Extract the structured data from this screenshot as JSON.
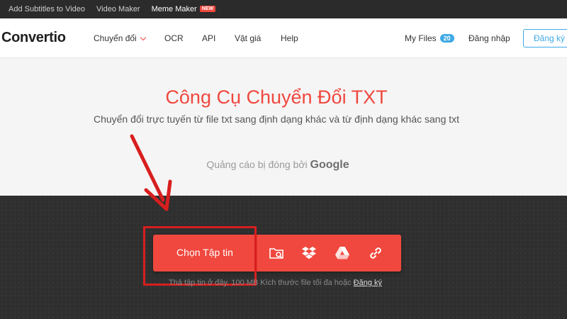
{
  "topbar": {
    "links": [
      "Add Subtitles to Video",
      "Video Maker",
      "Meme Maker"
    ],
    "new_badge": "NEW"
  },
  "header": {
    "logo": "Convertio",
    "nav": [
      "Chuyển đổi",
      "OCR",
      "API",
      "Vật giá",
      "Help"
    ],
    "my_files": "My Files",
    "files_count": "20",
    "login": "Đăng nhập",
    "signup": "Đăng ký"
  },
  "hero": {
    "title": "Công Cụ Chuyển Đổi TXT",
    "subtitle": "Chuyển đổi trực tuyến từ file txt sang định dạng khác và từ định dạng khác sang txt",
    "ad_text": "Quảng cáo bị đóng bởi",
    "ad_brand": "Google"
  },
  "upload": {
    "choose_label": "Chọn Tập tin",
    "icons": [
      "folder-search-icon",
      "dropbox-icon",
      "google-drive-icon",
      "link-icon"
    ],
    "limit_text": "Thả tập tin ở đây. 100 MB Kích thước file tối đa hoặc",
    "limit_link": "Đăng ký"
  },
  "colors": {
    "accent": "#f0483e",
    "link_blue": "#3fa9e6",
    "annotation_red": "#d81e1e",
    "dark_bg": "#2f2f2f"
  }
}
